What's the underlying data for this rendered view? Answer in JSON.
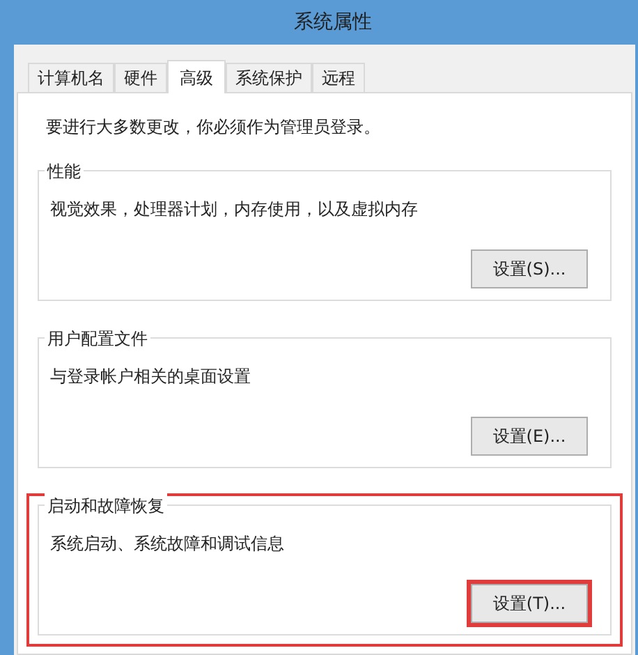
{
  "window": {
    "title": "系统属性"
  },
  "tabs": [
    {
      "label": "计算机名",
      "selected": false
    },
    {
      "label": "硬件",
      "selected": false
    },
    {
      "label": "高级",
      "selected": true
    },
    {
      "label": "系统保护",
      "selected": false
    },
    {
      "label": "远程",
      "selected": false
    }
  ],
  "notice": "要进行大多数更改，你必须作为管理员登录。",
  "groups": [
    {
      "title": "性能",
      "description": "视觉效果，处理器计划，内存使用，以及虚拟内存",
      "button": "设置(S)...",
      "highlighted": false
    },
    {
      "title": "用户配置文件",
      "description": "与登录帐户相关的桌面设置",
      "button": "设置(E)...",
      "highlighted": false
    },
    {
      "title": "启动和故障恢复",
      "description": "系统启动、系统故障和调试信息",
      "button": "设置(T)...",
      "highlighted": true
    }
  ]
}
